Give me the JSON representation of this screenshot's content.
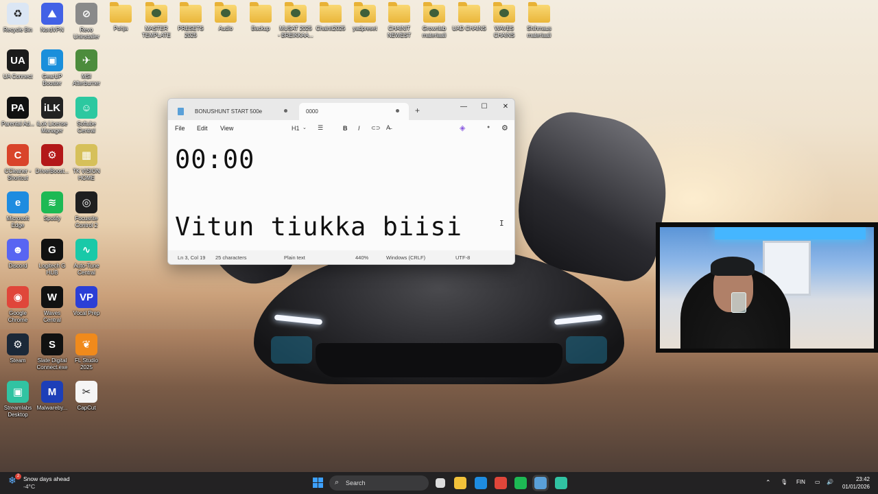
{
  "desktop": {
    "icons": [
      {
        "label": "Recycle Bin",
        "glyph": "♻",
        "color": "#dbe6f4"
      },
      {
        "label": "NordVPN",
        "glyph": "⛰",
        "color": "#4261e6"
      },
      {
        "label": "Revo Uninstaller",
        "glyph": "⊘",
        "color": "#8a8a8a"
      },
      {
        "label": "Pohja",
        "type": "folder"
      },
      {
        "label": "MASTER TEMPLATE",
        "type": "folder"
      },
      {
        "label": "PRESETS 2025",
        "type": "folder"
      },
      {
        "label": "Audio",
        "type": "folder"
      },
      {
        "label": "Backup",
        "type": "folder"
      },
      {
        "label": "MUSAT 2025 - BREIKKAA...",
        "type": "folder"
      },
      {
        "label": "Chainit2025",
        "type": "folder"
      },
      {
        "label": "yadpreset",
        "type": "folder"
      },
      {
        "label": "CHAINIT NEWEST",
        "type": "folder"
      },
      {
        "label": "Grownlab materiaali",
        "type": "folder"
      },
      {
        "label": "UAD CHAINS",
        "type": "folder"
      },
      {
        "label": "WAVES CHAINS",
        "type": "folder"
      },
      {
        "label": "Shihmaus materiaali",
        "type": "folder"
      },
      {
        "label": "UA Connect",
        "glyph": "UA",
        "color": "#1b1b1b"
      },
      {
        "label": "GearUP Booster",
        "glyph": "▣",
        "color": "#1a8fdb"
      },
      {
        "label": "MSI Afterburner",
        "glyph": "✈",
        "color": "#4c8c3c"
      },
      {
        "label": "Parental Ad...",
        "glyph": "PA",
        "color": "#111111"
      },
      {
        "label": "iLok License Manager",
        "glyph": "iLK",
        "color": "#222222"
      },
      {
        "label": "Softube Central",
        "glyph": "☺",
        "color": "#2cc8a0"
      },
      {
        "label": "CCleaner - Shortcut",
        "glyph": "C",
        "color": "#d9442a"
      },
      {
        "label": "DriverBoost...",
        "glyph": "⚙",
        "color": "#b31818"
      },
      {
        "label": "TK VISION HOME",
        "glyph": "▦",
        "color": "#d6c05a"
      },
      {
        "label": "Microsoft Edge",
        "glyph": "e",
        "color": "#1e8ce0"
      },
      {
        "label": "Spotify",
        "glyph": "≋",
        "color": "#1db954"
      },
      {
        "label": "Focusrite Control 2",
        "glyph": "◎",
        "color": "#1f1f1f"
      },
      {
        "label": "Discord",
        "glyph": "☻",
        "color": "#5865f2"
      },
      {
        "label": "Logitech G HUB",
        "glyph": "G",
        "color": "#111111"
      },
      {
        "label": "Auto-Tune Central",
        "glyph": "∿",
        "color": "#19c9a8"
      },
      {
        "label": "Google Chrome",
        "glyph": "◉",
        "color": "#e0463a"
      },
      {
        "label": "Waves Central",
        "glyph": "W",
        "color": "#111111"
      },
      {
        "label": "Vocal Prep",
        "glyph": "VP",
        "color": "#2b3fd6"
      },
      {
        "label": "Steam",
        "glyph": "⚙",
        "color": "#1b2838"
      },
      {
        "label": "Slate Digital Connect.exe",
        "glyph": "S",
        "color": "#111111"
      },
      {
        "label": "FL Studio 2025",
        "glyph": "❦",
        "color": "#f08a1c"
      },
      {
        "label": "Streamlabs Desktop",
        "glyph": "▣",
        "color": "#31c3a2"
      },
      {
        "label": "Malwareby...",
        "glyph": "M",
        "color": "#1d3fb8"
      },
      {
        "label": "CapCut",
        "glyph": "✂",
        "color": "#f5f5f5"
      }
    ]
  },
  "notepad": {
    "tabs": [
      {
        "label": "BONUSHUNT START 500e"
      },
      {
        "label": "0000"
      }
    ],
    "new_tab": "+",
    "window_controls": {
      "minimize": "—",
      "maximize": "☐",
      "close": "✕"
    },
    "menu": {
      "file": "File",
      "edit": "Edit",
      "view": "View"
    },
    "toolbar": {
      "heading": "H1",
      "list": "☰",
      "bold": "B",
      "italic": "I",
      "link": "⊂⊃",
      "format": "A̶",
      "copilot": "◈",
      "account": "●",
      "settings": "⚙"
    },
    "content": {
      "line1": "00:00",
      "line3": "Vitun tiukka biisi"
    },
    "status": {
      "position": "Ln 3, Col 19",
      "characters": "25 characters",
      "format": "Plain text",
      "zoom": "440%",
      "line_ending": "Windows (CRLF)",
      "encoding": "UTF-8"
    }
  },
  "taskbar": {
    "weather": {
      "title": "Snow days ahead",
      "temp": "-4°C",
      "badge": "2"
    },
    "search_placeholder": "Search",
    "apps": [
      {
        "name": "file-explorer",
        "color": "#f2c23a"
      },
      {
        "name": "edge",
        "color": "#1e8ce0"
      },
      {
        "name": "chrome",
        "color": "#e0463a"
      },
      {
        "name": "spotify",
        "color": "#1db954"
      },
      {
        "name": "notepad",
        "color": "#5aa0d8"
      },
      {
        "name": "streamlabs",
        "color": "#31c3a2"
      }
    ],
    "language": "FIN",
    "time": "23:42",
    "date": "01/01/2026"
  }
}
